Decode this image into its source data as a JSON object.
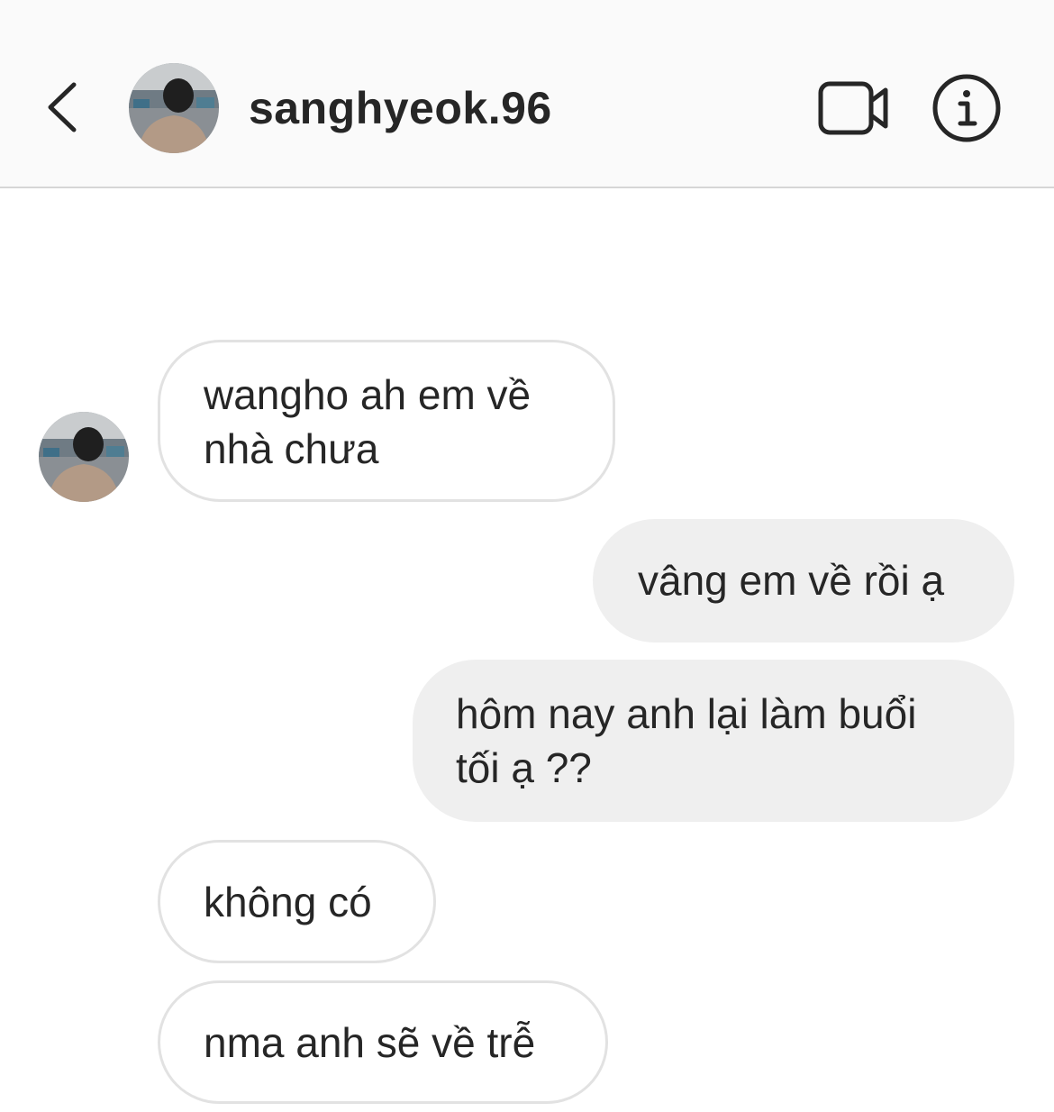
{
  "header": {
    "username": "sanghyeok.96",
    "back_icon": "chevron-left-icon",
    "video_icon": "video-camera-icon",
    "info_icon": "info-icon"
  },
  "messages": [
    {
      "direction": "received",
      "lines": [
        "wangho ah em về",
        "nhà chưa"
      ]
    },
    {
      "direction": "sent",
      "lines": [
        "vâng em về rồi ạ"
      ]
    },
    {
      "direction": "sent",
      "lines": [
        "hôm nay anh lại làm buổi",
        "tối ạ ??"
      ]
    },
    {
      "direction": "received",
      "lines": [
        "không có"
      ]
    },
    {
      "direction": "received",
      "lines": [
        "nma anh sẽ về trễ"
      ]
    }
  ],
  "colors": {
    "header_bg": "#fafafa",
    "sent_bubble": "#efefef",
    "received_border": "#e2e2e2",
    "text": "#262626"
  }
}
